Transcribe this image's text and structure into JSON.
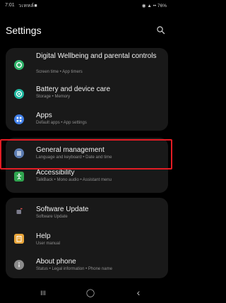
{
  "status_bar": {
    "time": "7:01",
    "notifications": "วเหหล์■",
    "system": "◉ ▲ •• 76%"
  },
  "header": {
    "title": "Settings",
    "search_icon": "search-icon"
  },
  "groups": [
    {
      "items": [
        {
          "title": "Digital Wellbeing and parental controls",
          "subtitle": "Screen time • App timers",
          "icon": "wellbeing-icon",
          "color": "#2fb36a"
        },
        {
          "title": "Battery and device care",
          "subtitle": "Storage • Memory",
          "icon": "device-care-icon",
          "color": "#1fb8a0"
        },
        {
          "title": "Apps",
          "subtitle": "Default apps • App settings",
          "icon": "apps-icon",
          "color": "#3f7ee8"
        }
      ]
    },
    {
      "items": [
        {
          "title": "General management",
          "subtitle": "Language and keyboard • Date and time",
          "icon": "general-management-icon",
          "color": "#5b7bb0"
        },
        {
          "title": "Accessibility",
          "subtitle": "TalkBack • Mono audio • Assistant menu",
          "icon": "accessibility-icon",
          "color": "#2fa44f"
        }
      ]
    },
    {
      "items": [
        {
          "title": "Software Update",
          "subtitle": "Software Update",
          "icon": "software-update-icon",
          "color": "#6a6a7a"
        },
        {
          "title": "Help",
          "subtitle": "User manual",
          "icon": "help-icon",
          "color": "#e8a53a"
        },
        {
          "title": "About phone",
          "subtitle": "Status • Legal information • Phone name",
          "icon": "about-phone-icon",
          "color": "#8a8a8a"
        }
      ]
    }
  ],
  "highlight_color": "#e31c24",
  "nav_bar": {
    "recents": "III",
    "home": "◯",
    "back": "‹"
  }
}
